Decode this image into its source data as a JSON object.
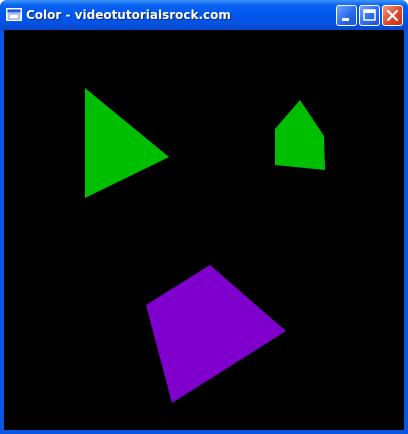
{
  "window": {
    "title": "Color - videotutorialsrock.com"
  },
  "titlebar": {
    "icons": {
      "app": "window-app-icon",
      "minimize": "minimize-icon",
      "maximize": "maximize-icon",
      "close": "close-icon"
    }
  },
  "colors": {
    "canvas_background": "#000000",
    "green_shape": "#00BF00",
    "purple_shape": "#7F00CC",
    "frame_blue": "#0A56E2",
    "close_red": "#E0462A"
  }
}
